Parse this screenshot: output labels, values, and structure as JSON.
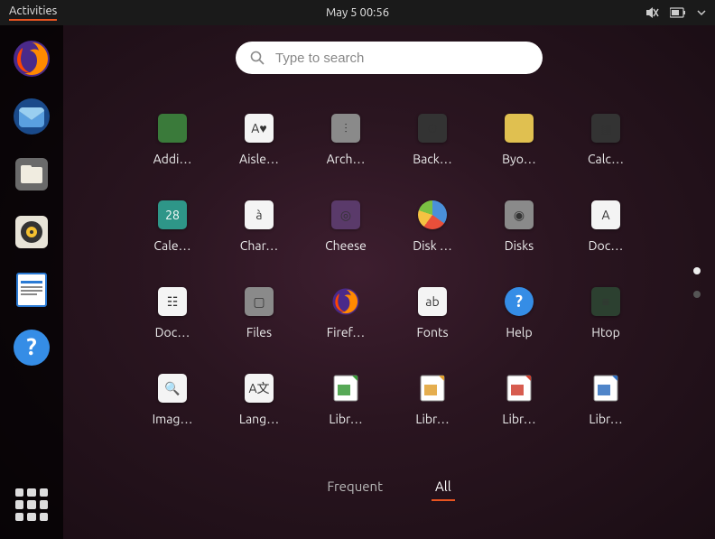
{
  "topbar": {
    "activities": "Activities",
    "datetime": "May 5  00:56"
  },
  "search": {
    "placeholder": "Type to search"
  },
  "dock": [
    {
      "name": "firefox"
    },
    {
      "name": "thunderbird"
    },
    {
      "name": "files"
    },
    {
      "name": "rhythmbox"
    },
    {
      "name": "libreoffice-writer"
    },
    {
      "name": "help"
    }
  ],
  "apps": [
    {
      "label": "Addi…",
      "name": "additional-drivers",
      "cls": "ic-green"
    },
    {
      "label": "Aisle…",
      "name": "aisleriot",
      "cls": "ic-white",
      "glyph": "A♥"
    },
    {
      "label": "Arch…",
      "name": "archive-manager",
      "cls": "ic-grey",
      "glyph": "⫶"
    },
    {
      "label": "Back…",
      "name": "backups",
      "cls": "ic-dark",
      "glyph": "⏱"
    },
    {
      "label": "Byo…",
      "name": "byobu",
      "cls": "ic-yellow"
    },
    {
      "label": "Calc…",
      "name": "calculator",
      "cls": "ic-dark",
      "glyph": "▦"
    },
    {
      "label": "Cale…",
      "name": "calendar",
      "cls": "ic-teal",
      "glyph": "28"
    },
    {
      "label": "Char…",
      "name": "characters",
      "cls": "ic-white",
      "glyph": "à"
    },
    {
      "label": "Cheese",
      "name": "cheese",
      "cls": "ic-purple",
      "glyph": "◎"
    },
    {
      "label": "Disk …",
      "name": "disk-usage",
      "cls": "ic-disk"
    },
    {
      "label": "Disks",
      "name": "disks",
      "cls": "ic-grey",
      "glyph": "◉"
    },
    {
      "label": "Doc…",
      "name": "document-scanner",
      "cls": "ic-white",
      "glyph": "A"
    },
    {
      "label": "Doc…",
      "name": "document-viewer",
      "cls": "ic-white",
      "glyph": "☷"
    },
    {
      "label": "Files",
      "name": "files",
      "cls": "ic-grey",
      "glyph": "▢"
    },
    {
      "label": "Firef…",
      "name": "firefox",
      "cls": "ic-white"
    },
    {
      "label": "Fonts",
      "name": "fonts",
      "cls": "ic-white",
      "glyph": "ab"
    },
    {
      "label": "Help",
      "name": "help",
      "cls": "ic-help",
      "glyph": "?"
    },
    {
      "label": "Htop",
      "name": "htop",
      "cls": "ic-darkgreen",
      "glyph": "≡"
    },
    {
      "label": "Imag…",
      "name": "image-viewer",
      "cls": "ic-white",
      "glyph": "🔍"
    },
    {
      "label": "Lang…",
      "name": "language-support",
      "cls": "ic-white",
      "glyph": "A文"
    },
    {
      "label": "Libr…",
      "name": "libreoffice-calc",
      "cls": "ic-white"
    },
    {
      "label": "Libr…",
      "name": "libreoffice-draw",
      "cls": "ic-white"
    },
    {
      "label": "Libr…",
      "name": "libreoffice-impress",
      "cls": "ic-white"
    },
    {
      "label": "Libr…",
      "name": "libreoffice-math",
      "cls": "ic-white"
    }
  ],
  "tabs": {
    "frequent": "Frequent",
    "all": "All",
    "active": "all"
  },
  "colors": {
    "accent": "#e95420"
  }
}
